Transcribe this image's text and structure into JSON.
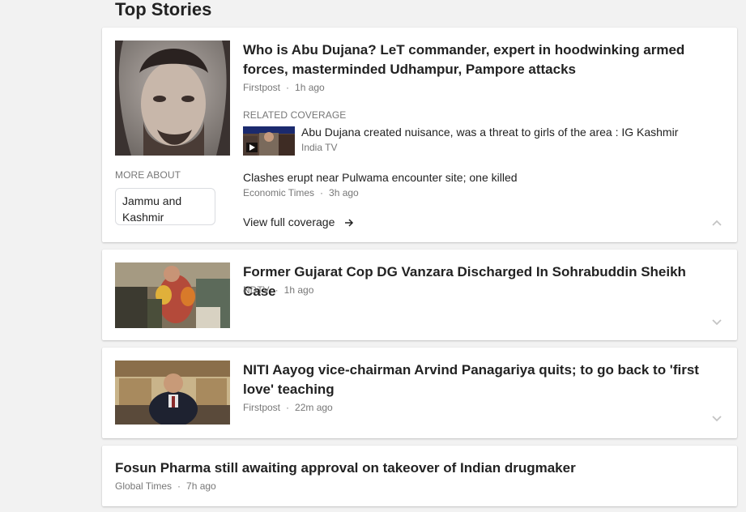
{
  "section": {
    "title": "Top Stories"
  },
  "stories": [
    {
      "headline": "Who is Abu Dujana? LeT commander, expert in hoodwinking armed forces, masterminded Udhampur, Pampore attacks",
      "source": "Firstpost",
      "time": "1h ago",
      "related_label": "RELATED COVERAGE",
      "related": [
        {
          "title": "Abu Dujana created nuisance, was a threat to girls of the area : IG Kashmir",
          "source": "India TV"
        },
        {
          "title": "Clashes erupt near Pulwama encounter site; one killed",
          "source": "Economic Times",
          "time": "3h ago"
        }
      ],
      "more_about_label": "MORE ABOUT",
      "topic_chip": "Jammu and Kashmir",
      "view_full_coverage": "View full coverage"
    },
    {
      "headline": "Former Gujarat Cop DG Vanzara Discharged In Sohrabuddin Sheikh Case",
      "source": "NDTV",
      "time": "1h ago"
    },
    {
      "headline": "NITI Aayog vice-chairman Arvind Panagariya quits; to go back to 'first love' teaching",
      "source": "Firstpost",
      "time": "22m ago"
    },
    {
      "headline": "Fosun Pharma still awaiting approval on takeover of Indian drugmaker",
      "source": "Global Times",
      "time": "7h ago"
    }
  ],
  "icons": {
    "chevron_up": "chevron-up-icon",
    "chevron_down": "chevron-down-icon",
    "arrow_right": "arrow-right-icon",
    "play": "play-icon"
  },
  "colors": {
    "text": "#222222",
    "meta": "#777777",
    "background": "#f2f2f2",
    "card": "#ffffff"
  }
}
